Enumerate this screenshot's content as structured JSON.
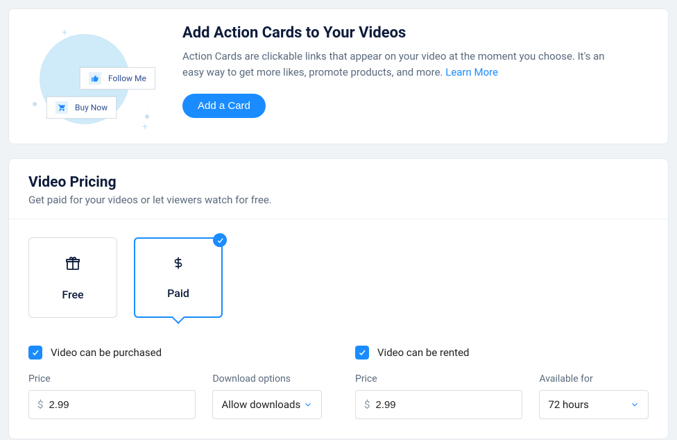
{
  "actionCards": {
    "title": "Add Action Cards to Your Videos",
    "description": "Action Cards are clickable links that appear on your video at the moment you choose. It's an easy way to get more likes, promote products, and more. ",
    "learnMore": "Learn More",
    "button": "Add a Card",
    "illus": {
      "card1": "Follow Me",
      "card2": "Buy Now"
    }
  },
  "pricing": {
    "title": "Video Pricing",
    "subtitle": "Get paid for your videos or let viewers watch for free.",
    "options": {
      "free": "Free",
      "paid": "Paid"
    },
    "purchase": {
      "checkbox": "Video can be purchased",
      "priceLabel": "Price",
      "priceValue": "2.99",
      "currency": "$",
      "downloadLabel": "Download options",
      "downloadValue": "Allow downloads"
    },
    "rent": {
      "checkbox": "Video can be rented",
      "priceLabel": "Price",
      "priceValue": "2.99",
      "currency": "$",
      "availableLabel": "Available for",
      "availableValue": "72 hours"
    }
  }
}
